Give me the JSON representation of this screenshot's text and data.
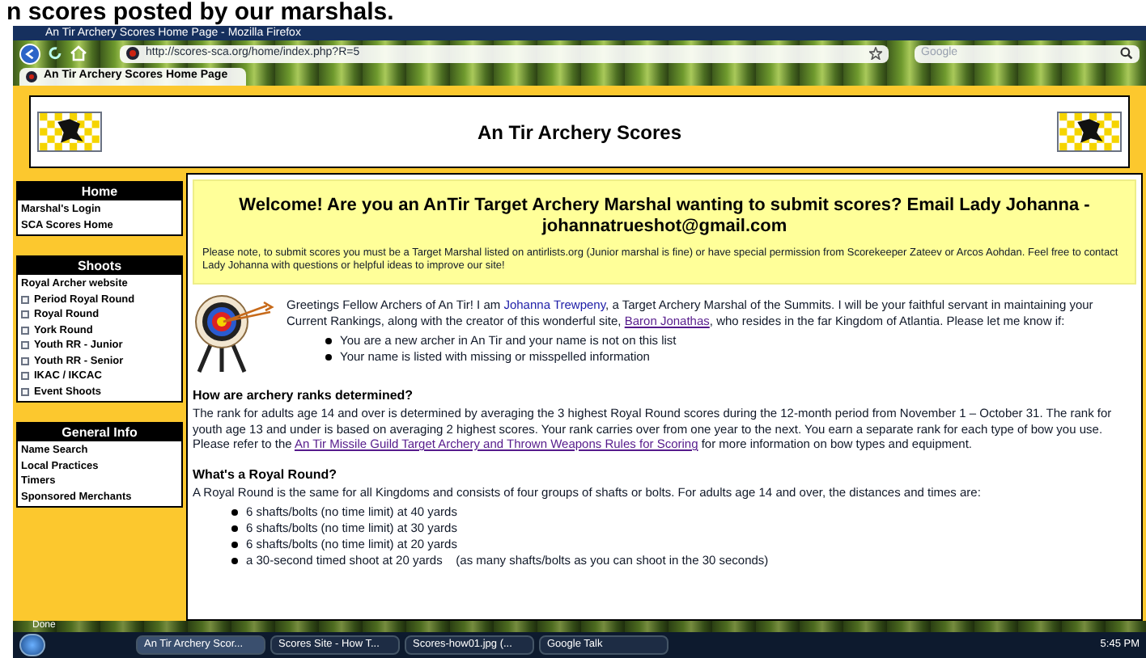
{
  "caption": "n scores posted by our marshals.",
  "browser": {
    "title": "An Tir Archery Scores Home Page - Mozilla Firefox",
    "url": "http://scores-sca.org/home/index.php?R=5",
    "search_placeholder": "Google",
    "tab_title": "An Tir Archery Scores Home Page"
  },
  "header": {
    "title": "An Tir Archery Scores"
  },
  "sidebar": [
    {
      "title": "Home",
      "items": [
        {
          "label": "Marshal's Login",
          "expandable": false
        },
        {
          "label": "SCA Scores Home",
          "expandable": false
        }
      ]
    },
    {
      "title": "Shoots",
      "items": [
        {
          "label": "Royal Archer website",
          "expandable": false
        },
        {
          "label": "Period Royal Round",
          "expandable": true
        },
        {
          "label": "Royal Round",
          "expandable": true
        },
        {
          "label": "York Round",
          "expandable": true
        },
        {
          "label": "Youth RR - Junior",
          "expandable": true
        },
        {
          "label": "Youth RR - Senior",
          "expandable": true
        },
        {
          "label": "IKAC / IKCAC",
          "expandable": true
        },
        {
          "label": "Event Shoots",
          "expandable": true
        }
      ]
    },
    {
      "title": "General Info",
      "items": [
        {
          "label": "Name Search",
          "expandable": false
        },
        {
          "label": "Local Practices",
          "expandable": false
        },
        {
          "label": "Timers",
          "expandable": false
        },
        {
          "label": "Sponsored Merchants",
          "expandable": false
        }
      ]
    }
  ],
  "welcome": {
    "heading": "Welcome! Are you an AnTir Target Archery Marshal wanting to submit scores? Email Lady Johanna - johannatrueshot@gmail.com",
    "note": "Please note, to submit scores you must be a Target Marshal listed on antirlists.org (Junior marshal is fine) or have special permission from Scorekeeper Zateev or Arcos Aohdan. Feel free to contact Lady Johanna with questions or helpful ideas to improve our site!"
  },
  "intro": {
    "segments": [
      {
        "kind": "text",
        "text": "Greetings Fellow Archers of An Tir! I am "
      },
      {
        "kind": "name",
        "text": "Johanna Trewpeny"
      },
      {
        "kind": "text",
        "text": ", a Target Archery Marshal of the Summits. I will be your faithful servant in maintaining your Current Rankings, along with the creator of this wonderful site, "
      },
      {
        "kind": "link",
        "text": "Baron Jonathas"
      },
      {
        "kind": "text",
        "text": ", who resides in the far Kingdom of Atlantia. Please let me know if:"
      }
    ],
    "bullets": [
      "You are a new archer in An Tir and your name is not on this list",
      "Your name is listed with missing or misspelled information"
    ]
  },
  "sections": [
    {
      "heading": "How are archery ranks determined?",
      "segments": [
        {
          "kind": "text",
          "text": "The rank for adults age 14 and over is determined by averaging the 3 highest Royal Round scores during the 12-month period from November 1 – October 31. The rank for youth age 13 and under is based on averaging 2 highest scores. Your rank carries over from one year to the next. You earn a separate rank for each type of bow you use. Please refer to the "
        },
        {
          "kind": "link",
          "text": "An Tir Missile Guild Target Archery and Thrown Weapons Rules for Scoring"
        },
        {
          "kind": "text",
          "text": " for more information on bow types and equipment."
        }
      ]
    },
    {
      "heading": "What's a Royal Round?",
      "segments": [
        {
          "kind": "text",
          "text": "A Royal Round is the same for all Kingdoms and consists of four groups of shafts or bolts. For adults age 14 and over, the distances and times are:"
        }
      ],
      "bullets": [
        "6 shafts/bolts (no time limit) at 40 yards",
        "6 shafts/bolts (no time limit) at 30 yards",
        "6 shafts/bolts (no time limit) at 20 yards",
        "a 30-second timed shoot at 20 yards    (as many shafts/bolts as you can shoot in the 30 seconds)"
      ]
    }
  ],
  "status": "Done",
  "taskbar": {
    "items": [
      {
        "label": "An Tir Archery Scor...",
        "selected": true
      },
      {
        "label": "Scores Site - How T...",
        "selected": false
      },
      {
        "label": "Scores-how01.jpg (...",
        "selected": false
      },
      {
        "label": "Google Talk",
        "selected": false
      }
    ],
    "clock": "5:45 PM"
  }
}
